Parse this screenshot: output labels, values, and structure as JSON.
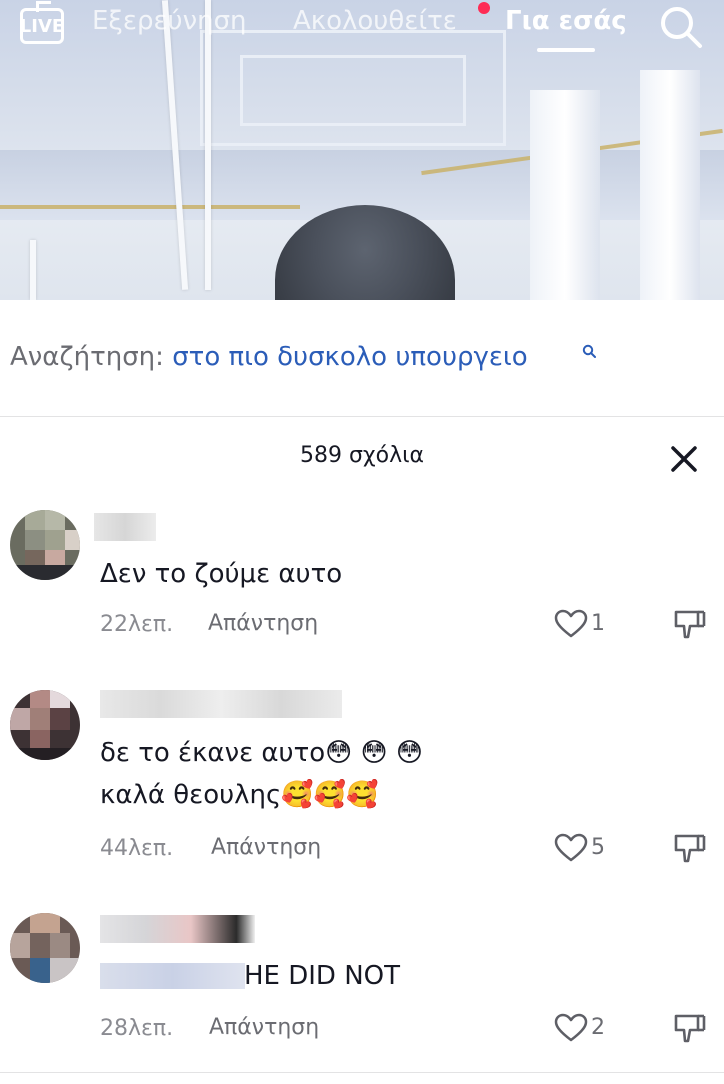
{
  "top_nav": {
    "live_label": "LIVE",
    "tabs": [
      {
        "label": "Εξερεύνηση"
      },
      {
        "label": "Ακολουθείτε"
      },
      {
        "label": "Για εσάς"
      }
    ],
    "active_tab": "Για εσάς",
    "notification_dot_color": "#fe2c55"
  },
  "search_suggestion": {
    "prefix": "Αναζήτηση:",
    "query": "στο πιο δυσκολο υπουργειο",
    "query_color": "#2b5db8"
  },
  "comments_panel": {
    "count_label": "589 σχόλια",
    "comments": [
      {
        "lines": [
          "Δεν το ζούμε αυτο"
        ],
        "time": "22λεπ.",
        "reply_label": "Απάντηση",
        "likes": "1"
      },
      {
        "lines": [
          "δε το έκανε αυτο😳 😳 😳",
          "καλά θεουλης🥰🥰🥰"
        ],
        "time": "44λεπ.",
        "reply_label": "Απάντηση",
        "likes": "5"
      },
      {
        "lines": [
          "HE DID NOT"
        ],
        "time": "28λεπ.",
        "reply_label": "Απάντηση",
        "likes": "2"
      }
    ]
  }
}
